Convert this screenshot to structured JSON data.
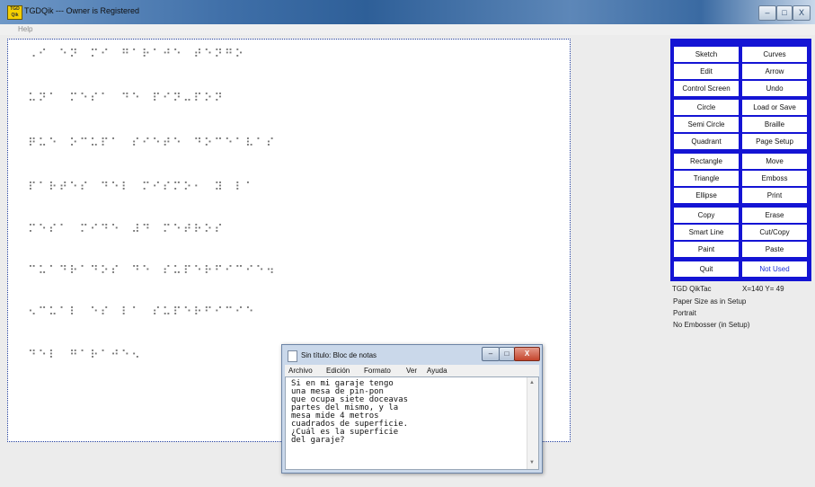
{
  "app": {
    "title": "TGDQik --- Owner is Registered",
    "icon_label": "TGD Qik",
    "icon": "tgdqik-app-icon"
  },
  "window_controls": {
    "minimize": "–",
    "maximize": "□",
    "close": "X"
  },
  "menu": {
    "help": "Help"
  },
  "braille_lines": [
    "⠠⠊⠀⠑⠝⠀⠍⠊⠀⠛⠁⠗⠁⠚⠑⠀⠞⠑⠝⠛⠕",
    "⠥⠝⠁⠀⠍⠑⠎⠁⠀⠙⠑⠀⠏⠊⠝⠤⠏⠕⠝",
    "⠟⠥⠑⠀⠕⠉⠥⠏⠁⠀⠎⠊⠑⠞⠑⠀⠙⠕⠉⠑⠁⠧⠁⠎",
    "⠏⠁⠗⠞⠑⠎⠀⠙⠑⠇⠀⠍⠊⠎⠍⠕⠂⠀⠽⠀⠇⠁",
    "⠍⠑⠎⠁⠀⠍⠊⠙⠑⠀⠼⠙⠀⠍⠑⠞⠗⠕⠎",
    "⠉⠥⠁⠙⠗⠁⠙⠕⠎⠀⠙⠑⠀⠎⠥⠏⠑⠗⠋⠊⠉⠊⠑⠲",
    "⠢⠉⠥⠁⠇⠀⠑⠎⠀⠇⠁⠀⠎⠥⠏⠑⠗⠋⠊⠉⠊⠑",
    "⠙⠑⠇⠀⠛⠁⠗⠁⠚⠑⠢"
  ],
  "tool_groups": [
    [
      [
        "Sketch",
        "Curves"
      ],
      [
        "Edit",
        "Arrow"
      ],
      [
        "Control Screen",
        "Undo"
      ]
    ],
    [
      [
        "Circle",
        "Load or Save"
      ],
      [
        "Semi Circle",
        "Braille"
      ],
      [
        "Quadrant",
        "Page Setup"
      ]
    ],
    [
      [
        "Rectangle",
        "Move"
      ],
      [
        "Triangle",
        "Emboss"
      ],
      [
        "Ellipse",
        "Print"
      ]
    ],
    [
      [
        "Copy",
        "Erase"
      ],
      [
        "Smart Line",
        "Cut/Copy"
      ],
      [
        "Paint",
        "Paste"
      ]
    ],
    [
      [
        "Quit",
        "Not Used"
      ]
    ]
  ],
  "status": {
    "device": "TGD QikTac",
    "coords": "X=140 Y= 49",
    "paper": "Paper Size as in Setup",
    "orientation": "Portrait",
    "embosser": "No Embosser  (in Setup)"
  },
  "colors": {
    "accent": "#1414d4",
    "not_used": "#1a2fd8"
  },
  "notepad": {
    "title": "Sin título: Bloc de notas",
    "menu": [
      "Archivo",
      "Edición",
      "Formato",
      "Ver",
      "Ayuda"
    ],
    "controls": {
      "minimize": "–",
      "maximize": "□",
      "close": "X"
    },
    "lines": [
      "Si en mi garaje tengo",
      "una mesa de pin-pon",
      "que ocupa siete doceavas",
      "partes del mismo, y la",
      "mesa mide 4 metros",
      "cuadrados de superficie.",
      "¿Cuál es la superficie",
      "del garaje?"
    ]
  }
}
